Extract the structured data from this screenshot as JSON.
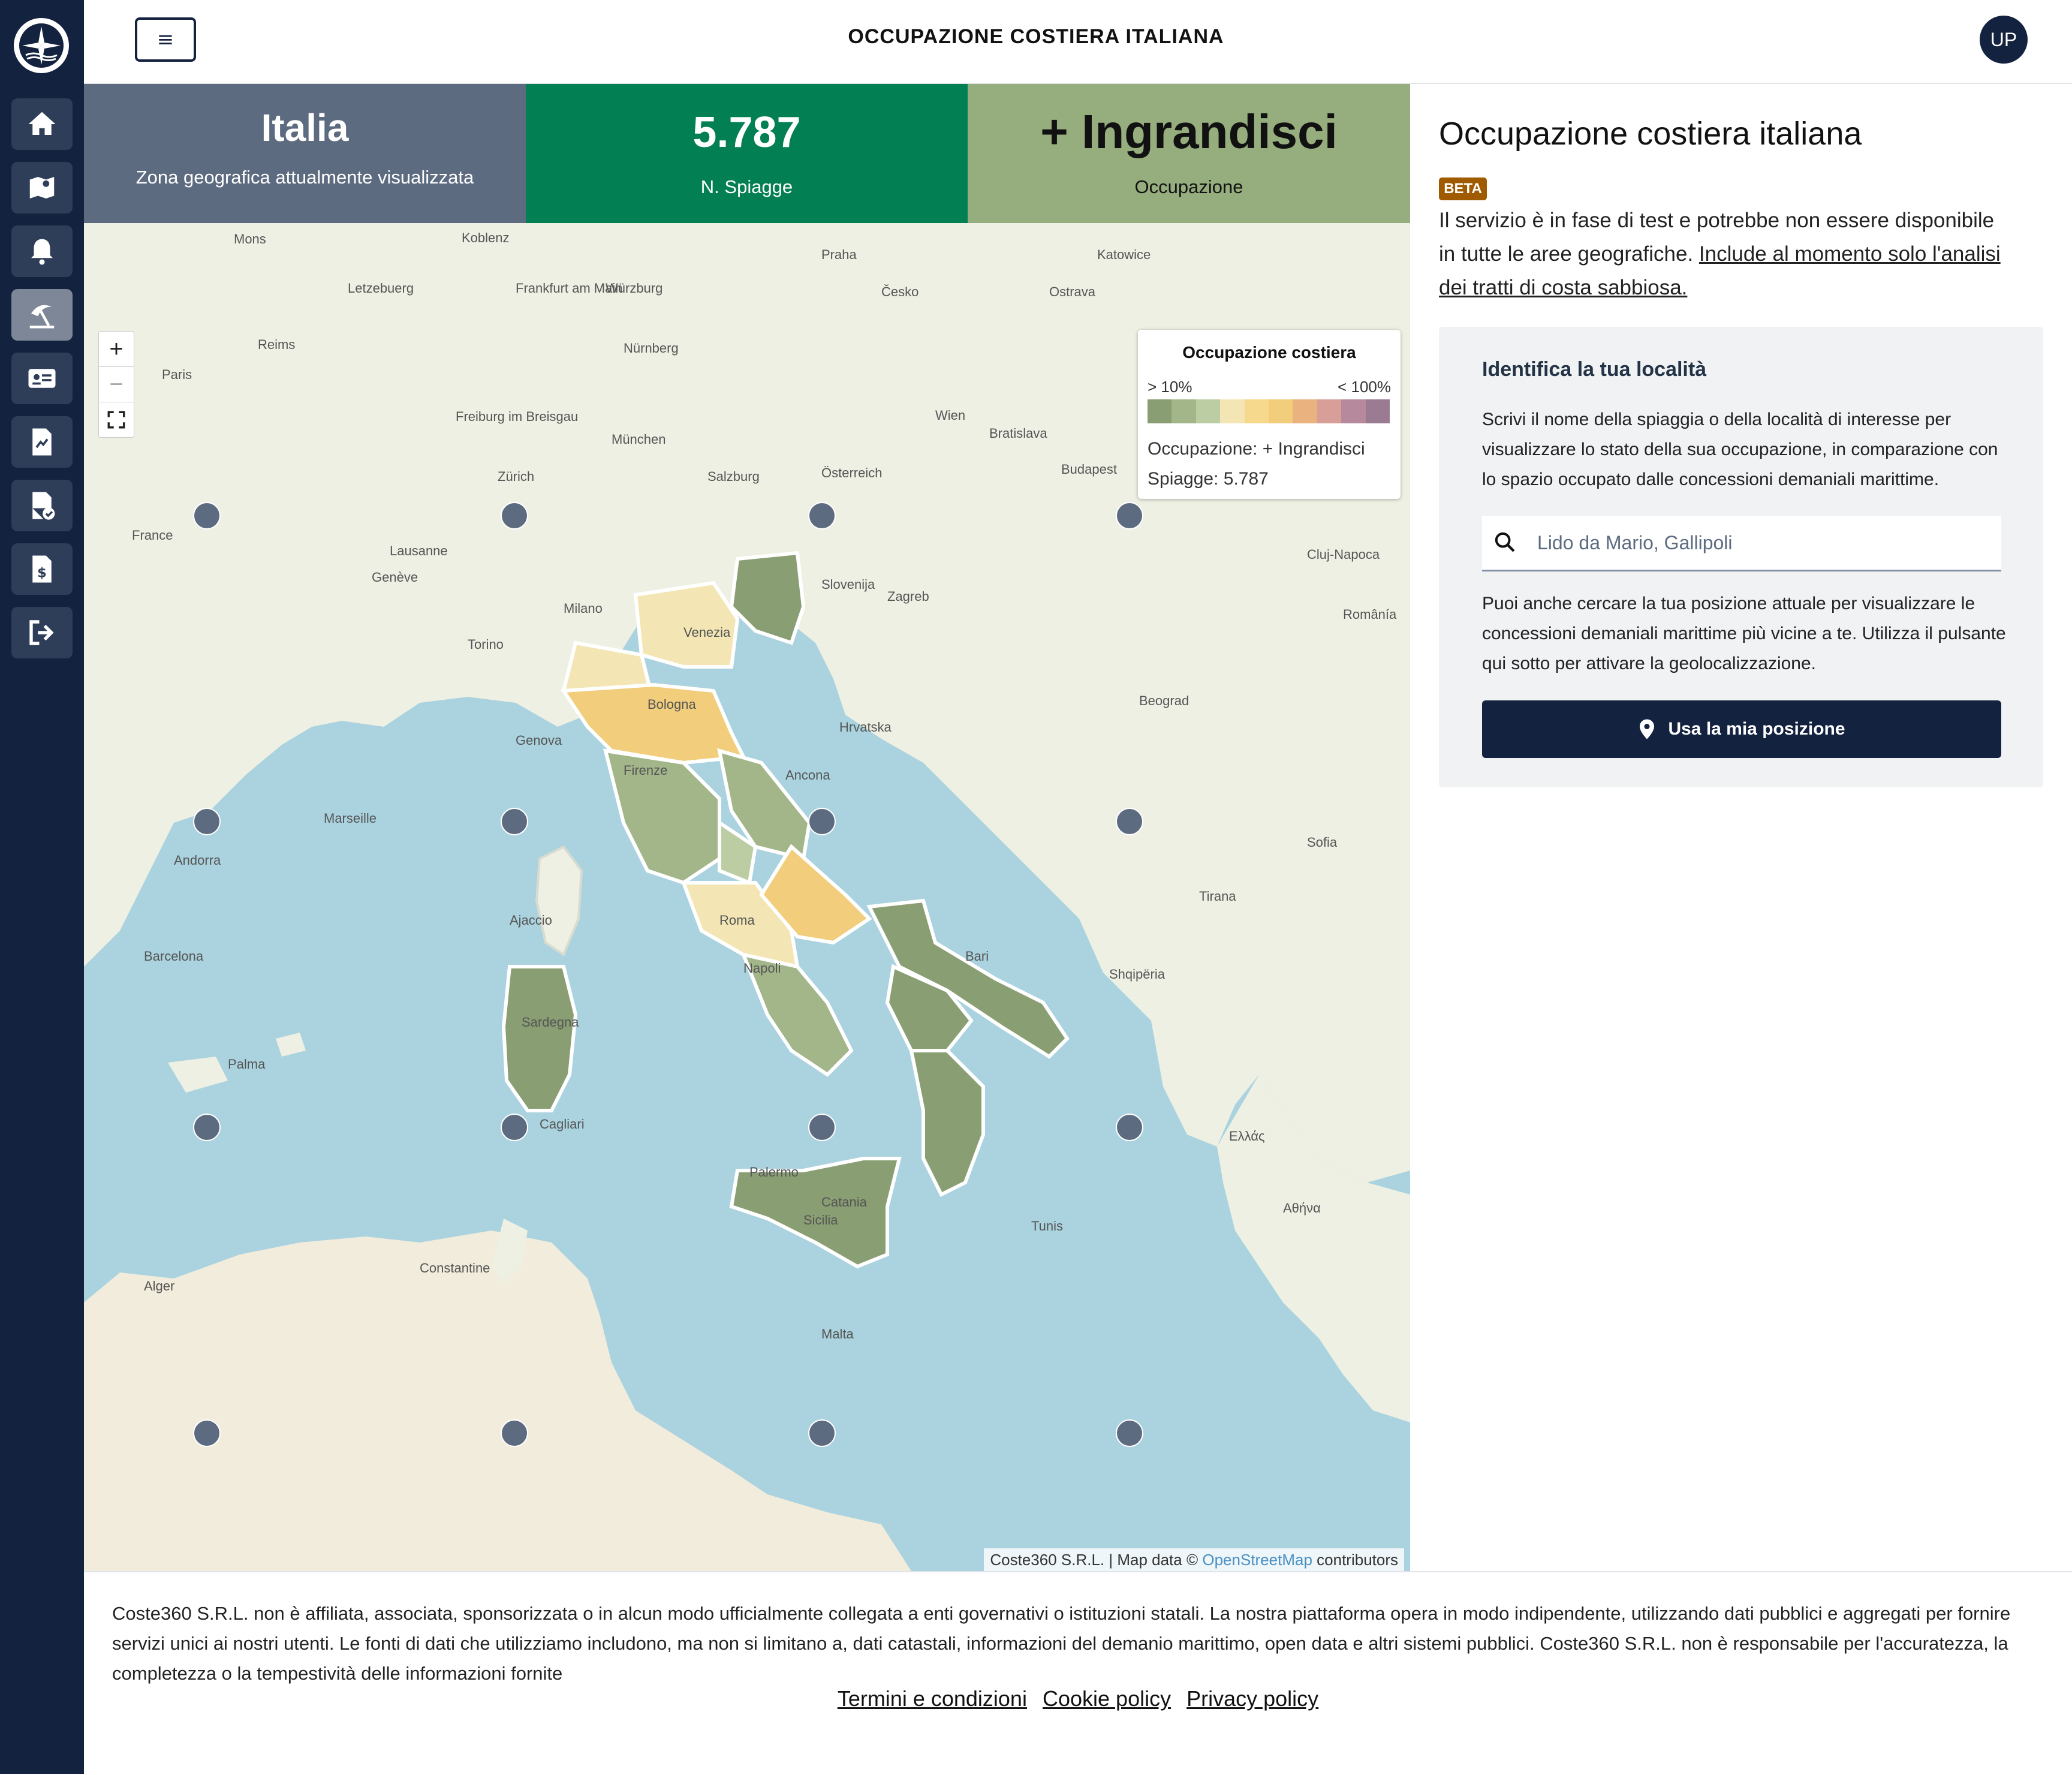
{
  "header": {
    "title": "OCCUPAZIONE COSTIERA ITALIANA",
    "menu_icon": "≡",
    "avatar": "UP"
  },
  "sidebar": {
    "items": [
      {
        "icon": "home-icon"
      },
      {
        "icon": "map-icon"
      },
      {
        "icon": "bell-icon"
      },
      {
        "icon": "beach-umbrella-icon",
        "active": true
      },
      {
        "icon": "id-card-icon"
      },
      {
        "icon": "document-chart-icon"
      },
      {
        "icon": "document-check-icon"
      },
      {
        "icon": "invoice-icon"
      },
      {
        "icon": "logout-icon"
      }
    ]
  },
  "stats": {
    "zone": {
      "value": "Italia",
      "label": "Zona geografica attualmente visualizzata",
      "color": "#5d6b80"
    },
    "beaches": {
      "value": "5.787",
      "label": "N. Spiagge",
      "color": "#027f53"
    },
    "occupancy": {
      "value": "+ Ingrandisci",
      "label": "Occupazione",
      "color": "#96ad7e"
    }
  },
  "map": {
    "zoom_in": "+",
    "zoom_out": "−",
    "legend": {
      "title": "Occupazione costiera",
      "min_label": "> 10%",
      "max_label": "< 100%",
      "colors": [
        "#8a9e73",
        "#a3b68a",
        "#bccda4",
        "#f3e6b4",
        "#f6d98c",
        "#f1cd7c",
        "#e9b27e",
        "#d79f98",
        "#b68a9c",
        "#9a7b92"
      ],
      "occupancy_text": "Occupazione: + Ingrandisci",
      "beaches_text": "Spiagge: 5.787"
    },
    "attribution": {
      "prefix": "Coste360 S.R.L. | Map data ©",
      "link": "OpenStreetMap",
      "suffix": "contributors"
    },
    "place_labels": [
      "Mons",
      "Koblenz",
      "Praha",
      "Katowice",
      "Letzebuerg",
      "Frankfurt am Main",
      "Würzburg",
      "Paris",
      "Reims",
      "Nürnberg",
      "Česko",
      "Ostrava",
      "Freiburg im Breisgau",
      "München",
      "Wien",
      "Bratislava",
      "Budapest",
      "Zürich",
      "Salzburg",
      "Österreich",
      "France",
      "Lausanne",
      "Genève",
      "Milano",
      "Slovenija",
      "Zagreb",
      "Venezia",
      "Torino",
      "Bologna",
      "Genova",
      "Firenze",
      "Hrvatska",
      "Beograd",
      "Marseille",
      "Ancona",
      "Roma",
      "Napoli",
      "Bari",
      "Andorra",
      "Barcelona",
      "Ajaccio",
      "Sardegna",
      "Cagliari",
      "Palermo",
      "Sicilia",
      "Catania",
      "Malta",
      "Tunis",
      "Alger",
      "Constantine",
      "Palma",
      "Shqipëria",
      "Ελλάς",
      "Αθήνα",
      "Românía",
      "Cluj-Napoca",
      "Sofia",
      "Tirana"
    ]
  },
  "panel": {
    "title": "Occupazione costiera italiana",
    "badge": "BETA",
    "description": "Il servizio è in fase di test e potrebbe non essere disponibile in tutte le aree geografiche.",
    "description_link": "Include al momento solo l'analisi dei tratti di costa sabbiosa.",
    "search": {
      "title": "Identifica la tua località",
      "description": "Scrivi il nome della spiaggia o della località di interesse per visualizzare lo stato della sua occupazione, in comparazione con lo spazio occupato dalle concessioni demaniali marittime.",
      "placeholder": "Lido da Mario, Gallipoli",
      "geo_description": "Puoi anche cercare la tua posizione attuale per visualizzare le concessioni demaniali marittime più vicine a te. Utilizza il pulsante qui sotto per attivare la geolocalizzazione.",
      "geo_button": "Usa la mia posizione"
    }
  },
  "footer": {
    "disclaimer": "Coste360 S.R.L. non è affiliata, associata, sponsorizzata o in alcun modo ufficialmente collegata a enti governativi o istituzioni statali. La nostra piattaforma opera in modo indipendente, utilizzando dati pubblici e aggregati per fornire servizi unici ai nostri utenti. Le fonti di dati che utilizziamo includono, ma non si limitano a, dati catastali, informazioni del demanio marittimo, open data e altri sistemi pubblici. Coste360 S.R.L. non è responsabile per l'accuratezza, la completezza o la tempestività delle informazioni fornite",
    "links": [
      "Termini e condizioni",
      "Cookie policy",
      "Privacy policy"
    ]
  }
}
